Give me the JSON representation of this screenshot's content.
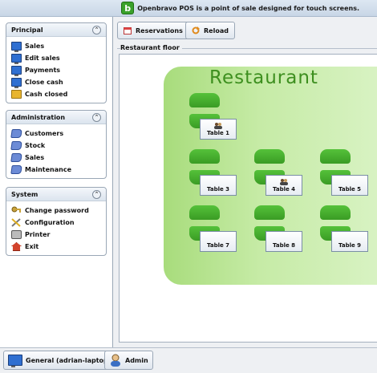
{
  "topbar": {
    "logo_letter": "b",
    "message": "Openbravo POS is a point of sale designed for touch screens."
  },
  "sidebar": {
    "principal": {
      "title": "Principal",
      "items": [
        {
          "label": "Sales",
          "icon": "monitor-icon"
        },
        {
          "label": "Edit sales",
          "icon": "monitor-icon"
        },
        {
          "label": "Payments",
          "icon": "monitor-icon"
        },
        {
          "label": "Close cash",
          "icon": "monitor-icon"
        },
        {
          "label": "Cash closed",
          "icon": "folder-icon"
        }
      ]
    },
    "administration": {
      "title": "Administration",
      "items": [
        {
          "label": "Customers",
          "icon": "book-icon"
        },
        {
          "label": "Stock",
          "icon": "book-icon"
        },
        {
          "label": "Sales",
          "icon": "book-icon"
        },
        {
          "label": "Maintenance",
          "icon": "book-icon"
        }
      ]
    },
    "system": {
      "title": "System",
      "items": [
        {
          "label": "Change password",
          "icon": "key-icon"
        },
        {
          "label": "Configuration",
          "icon": "tools-icon"
        },
        {
          "label": "Printer",
          "icon": "printer-icon"
        },
        {
          "label": "Exit",
          "icon": "home-icon"
        }
      ]
    }
  },
  "toolbar": {
    "reservations_label": "Reservations",
    "reload_label": "Reload"
  },
  "floor": {
    "title": "Restaurant floor",
    "room_name": "Restaurant",
    "tables": [
      {
        "label": "Table 1",
        "occupied": true
      },
      {
        "label": "Table 3",
        "occupied": false
      },
      {
        "label": "Table 4",
        "occupied": true
      },
      {
        "label": "Table 5",
        "occupied": false
      },
      {
        "label": "Table 7",
        "occupied": false
      },
      {
        "label": "Table 8",
        "occupied": false
      },
      {
        "label": "Table 9",
        "occupied": false
      }
    ]
  },
  "bottombar": {
    "host_label": "General (adrian-laptop)",
    "user_label": "Admin"
  },
  "colors": {
    "accent_green": "#3d8f1f",
    "chair_green": "#4ab130",
    "panel_border": "#9aa7b6"
  }
}
